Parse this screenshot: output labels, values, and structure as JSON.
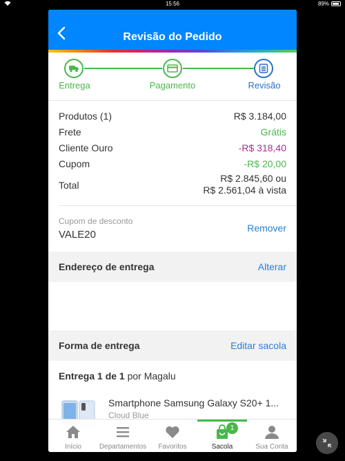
{
  "status_bar": {
    "time": "15:56",
    "battery": "89%",
    "battery_level": 0.89
  },
  "header": {
    "title": "Revisão do Pedido"
  },
  "steps": [
    {
      "label": "Entrega"
    },
    {
      "label": "Pagamento"
    },
    {
      "label": "Revisão"
    }
  ],
  "summary": {
    "products_label": "Produtos (1)",
    "products_value": "R$ 3.184,00",
    "shipping_label": "Frete",
    "shipping_value": "Grátis",
    "gold_label": "Cliente Ouro",
    "gold_value": "-R$ 318,40",
    "coupon_label": "Cupom",
    "coupon_value": "-R$ 20,00",
    "total_label": "Total",
    "total_value_1": "R$ 2.845,60 ou",
    "total_value_2": "R$ 2.561,04 à vista"
  },
  "coupon": {
    "label": "Cupom de desconto",
    "code": "VALE20",
    "action": "Remover"
  },
  "address": {
    "title": "Endereço de entrega",
    "action": "Alterar"
  },
  "delivery": {
    "title": "Forma de entrega",
    "action": "Editar sacola",
    "ship_count": "Entrega 1 de 1",
    "ship_by": "por Magalu"
  },
  "product": {
    "name": "Smartphone Samsung Galaxy S20+ 1...",
    "color": "Cloud Blue"
  },
  "tabbar": {
    "items": [
      {
        "label": "Início"
      },
      {
        "label": "Departamentos"
      },
      {
        "label": "Favoritos"
      },
      {
        "label": "Sacola",
        "badge": "1"
      },
      {
        "label": "Sua Conta"
      }
    ]
  },
  "colors": {
    "brand_blue": "#0086ff",
    "success_green": "#48b84a",
    "link_blue": "#2a7fd4",
    "purple": "#a3318e"
  }
}
